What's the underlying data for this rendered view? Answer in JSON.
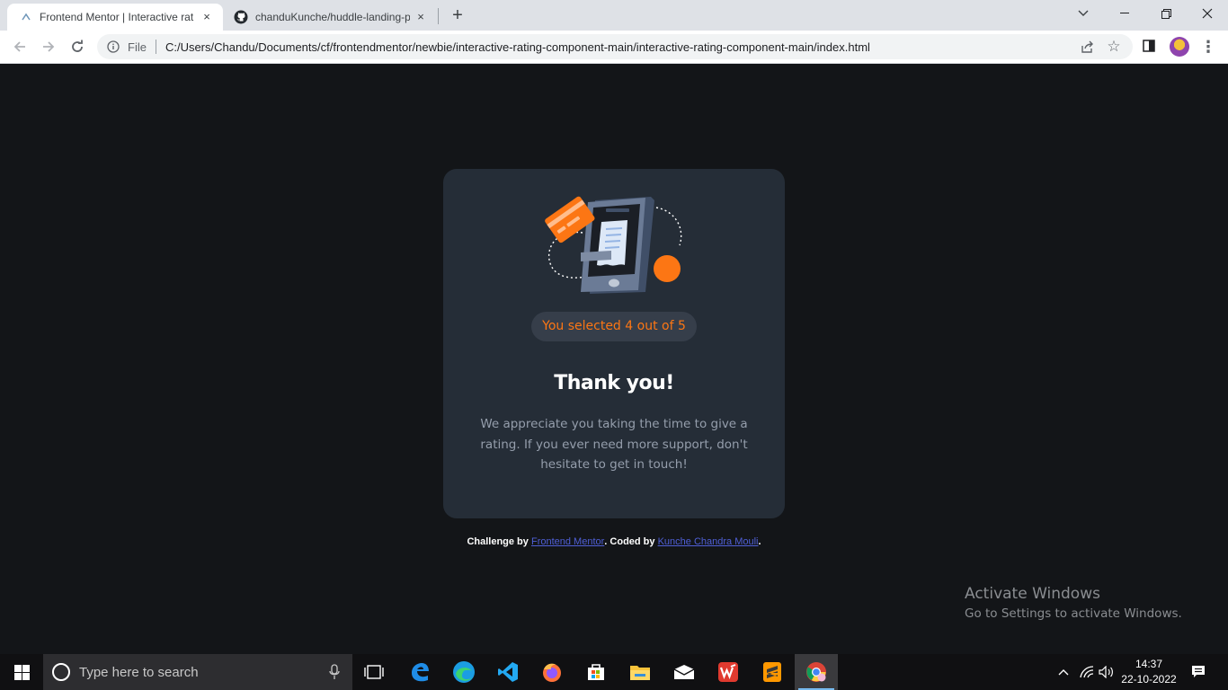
{
  "browser": {
    "tabs": [
      {
        "title": "Frontend Mentor | Interactive rat",
        "active": true,
        "close": "×"
      },
      {
        "title": "chanduKunche/huddle-landing-p",
        "active": false,
        "close": "×"
      }
    ],
    "new_tab_label": "+",
    "address": {
      "scheme_label": "File",
      "url": "C:/Users/Chandu/Documents/cf/frontendmentor/newbie/interactive-rating-component-main/interactive-rating-component-main/index.html"
    }
  },
  "card": {
    "selected_text": "You selected 4 out of 5",
    "heading": "Thank you!",
    "message": "We appreciate you taking the time to give a rating. If you ever need more support, don't hesitate to get in touch!"
  },
  "attribution": {
    "prefix": "Challenge by",
    "link1": "Frontend Mentor",
    "middle": ". Coded by",
    "link2": "Kunche Chandra Mouli",
    "suffix": "."
  },
  "watermark": {
    "title": "Activate Windows",
    "subtitle": "Go to Settings to activate Windows."
  },
  "taskbar": {
    "search_placeholder": "Type here to search",
    "time": "14:37",
    "date": "22-10-2022"
  },
  "colors": {
    "page_bg": "#131518",
    "card_bg": "#252d37",
    "accent_orange": "#fc7614",
    "pill_bg": "#363e4a",
    "body_text": "#959eac",
    "link": "#4f5fd6"
  }
}
